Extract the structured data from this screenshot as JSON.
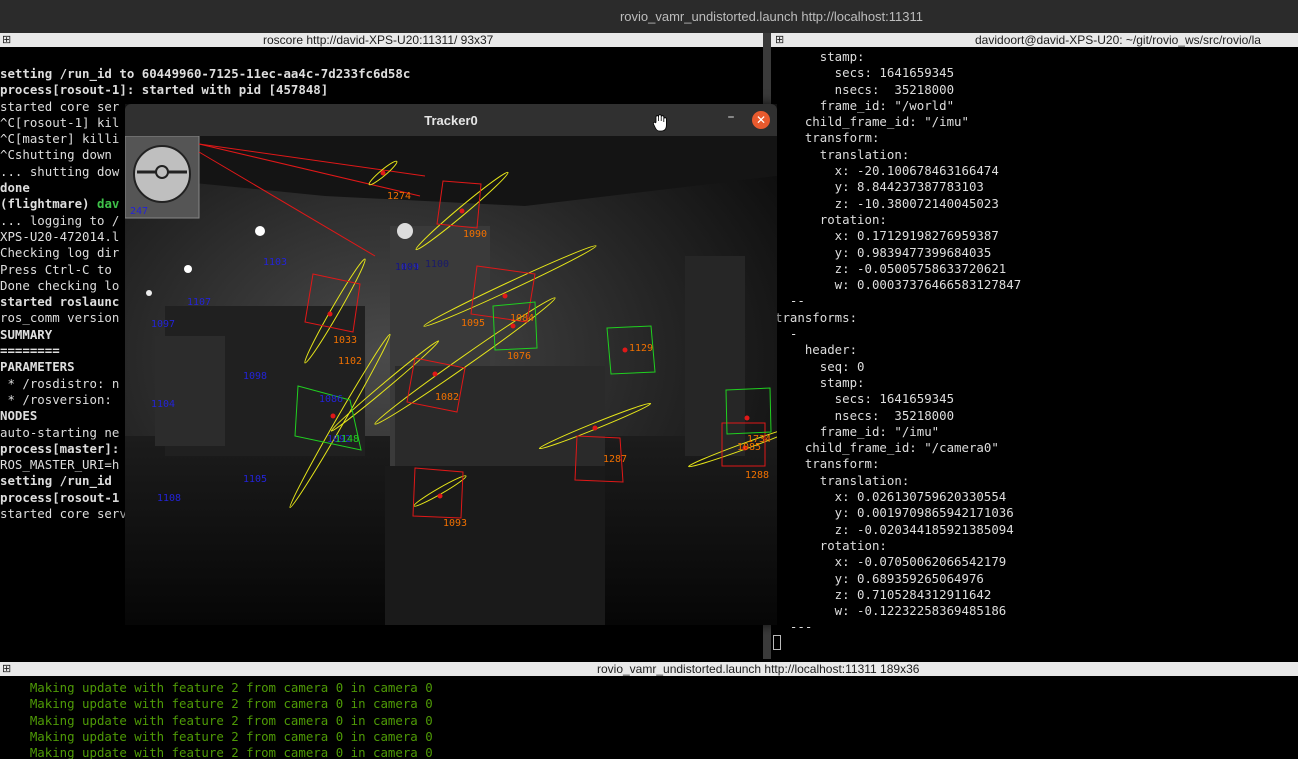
{
  "window_title": "rovio_vamr_undistorted.launch http://localhost:11311",
  "left_pane": {
    "title": "roscore http://david-XPS-U20:11311/ 93x37",
    "lines": [
      "setting /run_id to 60449960-7125-11ec-aa4c-7d233fc6d58c",
      "process[rosout-1]: started with pid [457848]",
      "started core ser",
      "^C[rosout-1] kil",
      "^C[master] killi",
      "^Cshutting down",
      "... shutting dow",
      "done",
      "(flightmare) dav",
      "... logging to /",
      "XPS-U20-472014.l",
      "Checking log dir",
      "Press Ctrl-C to",
      "Done checking lo",
      "",
      "started roslaunc",
      "ros_comm version",
      "",
      "",
      "SUMMARY",
      "========",
      "",
      "PARAMETERS",
      " * /rosdistro: n",
      " * /rosversion:",
      "",
      "NODES",
      "",
      "auto-starting ne",
      "process[master]:",
      "ROS_MASTER_URI=h",
      "",
      "setting /run_id",
      "process[rosout-1",
      "started core service [/rosout]"
    ]
  },
  "right_pane": {
    "title": "davidoort@david-XPS-U20: ~/git/rovio_ws/src/rovio/la",
    "lines": [
      "      stamp:",
      "        secs: 1641659345",
      "        nsecs:  35218000",
      "      frame_id: \"/world\"",
      "    child_frame_id: \"/imu\"",
      "    transform:",
      "      translation:",
      "        x: -20.100678463166474",
      "        y: 8.844237387783103",
      "        z: -10.380072140045023",
      "      rotation:",
      "        x: 0.17129198276959387",
      "        y: 0.9839477399684035",
      "        z: -0.05005758633720621",
      "        w: 0.00037376466583127847",
      "  --",
      "transforms:",
      "  -",
      "    header:",
      "      seq: 0",
      "      stamp:",
      "        secs: 1641659345",
      "        nsecs:  35218000",
      "      frame_id: \"/imu\"",
      "    child_frame_id: \"/camera0\"",
      "    transform:",
      "      translation:",
      "        x: 0.026130759620330554",
      "        y: 0.0019709865942171036",
      "        z: -0.020344185921385094",
      "      rotation:",
      "        x: -0.07050062066542179",
      "        y: 0.689359265064976",
      "        z: 0.7105284312911642",
      "        w: -0.12232258369485186",
      "",
      "  ---"
    ]
  },
  "bottom_pane": {
    "title": "rovio_vamr_undistorted.launch http://localhost:11311 189x36",
    "lines": [
      "    Making update with feature 2 from camera 0 in camera 0",
      "    Making update with feature 2 from camera 0 in camera 0",
      "    Making update with feature 2 from camera 0 in camera 0",
      "    Making update with feature 2 from camera 0 in camera 0",
      "    Making update with feature 2 from camera 0 in camera 0"
    ]
  },
  "tracker_window": {
    "title": "Tracker0",
    "minimize_glyph": "–",
    "close_glyph": "✕",
    "inset_label": "247",
    "red_labels": [
      "1274",
      "1090",
      "1084",
      "1095",
      "1033",
      "1102",
      "1082",
      "1076",
      "1129",
      "1287",
      "1093",
      "1085",
      "1734",
      "1288"
    ],
    "blue_labels": [
      "1103",
      "1107",
      "1097",
      "1098",
      "1104",
      "1086",
      "1092",
      "1105",
      "1108",
      "1099"
    ],
    "grey_labels": [
      "1101",
      "1100"
    ],
    "green_labels": [
      "1148"
    ]
  },
  "colors": {
    "feature_red": "#e01818",
    "feature_green": "#20d020",
    "ellipse_yellow": "#e6e619",
    "label_blue": "#2323d8",
    "label_orange": "#f07000",
    "terminal_green": "#4e9a06",
    "close_button": "#e85a2e"
  }
}
